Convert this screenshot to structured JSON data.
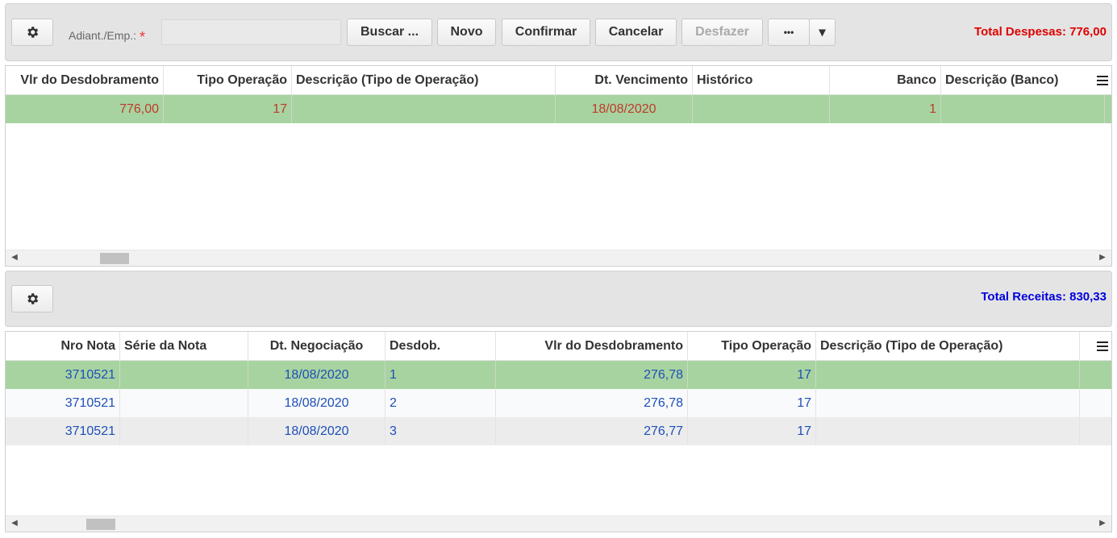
{
  "top_toolbar": {
    "field_label": "Adiant./Emp.:",
    "required_mark": "*",
    "field_value": "",
    "buttons": {
      "buscar": "Buscar ...",
      "novo": "Novo",
      "confirmar": "Confirmar",
      "cancelar": "Cancelar",
      "desfazer": "Desfazer",
      "more": "•••",
      "dropdown": "▾"
    },
    "total": "Total Despesas: 776,00"
  },
  "despesas_grid": {
    "columns": [
      "Vlr do Desdobramento",
      "Tipo Operação",
      "Descrição (Tipo de Operação)",
      "Dt. Vencimento",
      "Histórico",
      "Banco",
      "Descrição (Banco)"
    ],
    "rows": [
      [
        "776,00",
        "17",
        "",
        "18/08/2020",
        "",
        "1",
        ""
      ]
    ]
  },
  "bottom_toolbar": {
    "total": "Total Receitas: 830,33"
  },
  "receitas_grid": {
    "columns": [
      "Nro Nota",
      "Série da Nota",
      "Dt. Negociação",
      "Desdob.",
      "Vlr do Desdobramento",
      "Tipo Operação",
      "Descrição (Tipo de Operação)"
    ],
    "rows": [
      [
        "3710521",
        "",
        "18/08/2020",
        "1",
        "276,78",
        "17",
        ""
      ],
      [
        "3710521",
        "",
        "18/08/2020",
        "2",
        "276,78",
        "17",
        ""
      ],
      [
        "3710521",
        "",
        "18/08/2020",
        "3",
        "276,77",
        "17",
        ""
      ]
    ]
  },
  "colors": {
    "selected_row": "#a7d3a0",
    "total_despesas": "#e00000",
    "total_receitas": "#0000dd",
    "despesas_text": "#c0392b",
    "receitas_text": "#1d4fb8"
  },
  "icons": {
    "settings": "gear-icon",
    "column_menu": "hamburger-menu-icon",
    "scroll_left": "chevron-left-icon",
    "scroll_right": "chevron-right-icon"
  }
}
